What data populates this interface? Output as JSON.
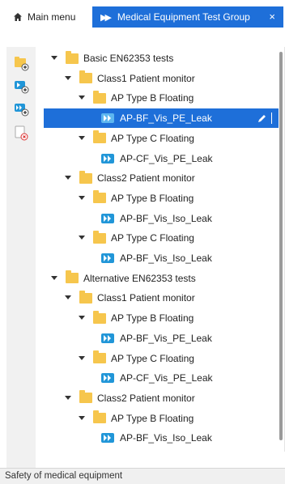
{
  "tabs": {
    "main": {
      "label": "Main menu",
      "icon": "home-icon"
    },
    "active": {
      "label": "Medical Equipment Test Group",
      "icon": "fast-forward-icon",
      "close": "×"
    }
  },
  "colors": {
    "accent": "#1e6fd9",
    "folder": "#f6c64d",
    "test_icon": "#2196d8"
  },
  "toolbar": {
    "buttons": [
      {
        "name": "add-folder-button",
        "icon": "folder-add-icon"
      },
      {
        "name": "add-test-button",
        "icon": "test-add-icon"
      },
      {
        "name": "add-sequence-button",
        "icon": "sequence-add-icon"
      },
      {
        "name": "delete-button",
        "icon": "delete-icon"
      }
    ]
  },
  "tree": {
    "nodes": [
      {
        "label": "Basic EN62353 tests",
        "type": "folder",
        "depth": 0
      },
      {
        "label": "Class1 Patient monitor",
        "type": "folder",
        "depth": 1
      },
      {
        "label": "AP Type B Floating",
        "type": "folder",
        "depth": 2
      },
      {
        "label": "AP-BF_Vis_PE_Leak",
        "type": "test",
        "depth": 3,
        "selected": true
      },
      {
        "label": "AP Type C Floating",
        "type": "folder",
        "depth": 2
      },
      {
        "label": "AP-CF_Vis_PE_Leak",
        "type": "test",
        "depth": 3
      },
      {
        "label": "Class2 Patient monitor",
        "type": "folder",
        "depth": 1
      },
      {
        "label": "AP Type B Floating",
        "type": "folder",
        "depth": 2
      },
      {
        "label": "AP-BF_Vis_Iso_Leak",
        "type": "test",
        "depth": 3
      },
      {
        "label": "AP Type C Floating",
        "type": "folder",
        "depth": 2
      },
      {
        "label": "AP-BF_Vis_Iso_Leak",
        "type": "test",
        "depth": 3
      },
      {
        "label": "Alternative EN62353 tests",
        "type": "folder",
        "depth": 0
      },
      {
        "label": "Class1 Patient monitor",
        "type": "folder",
        "depth": 1
      },
      {
        "label": "AP Type B Floating",
        "type": "folder",
        "depth": 2
      },
      {
        "label": "AP-BF_Vis_PE_Leak",
        "type": "test",
        "depth": 3
      },
      {
        "label": "AP Type C Floating",
        "type": "folder",
        "depth": 2
      },
      {
        "label": "AP-CF_Vis_PE_Leak",
        "type": "test",
        "depth": 3
      },
      {
        "label": "Class2 Patient monitor",
        "type": "folder",
        "depth": 1
      },
      {
        "label": "AP Type B Floating",
        "type": "folder",
        "depth": 2
      },
      {
        "label": "AP-BF_Vis_Iso_Leak",
        "type": "test",
        "depth": 3
      }
    ]
  },
  "status": {
    "text": "Safety of medical equipment"
  }
}
